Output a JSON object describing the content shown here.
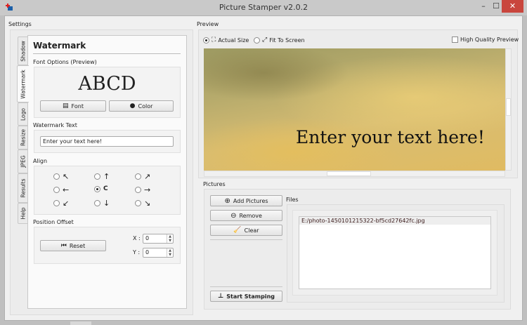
{
  "window": {
    "title": "Picture Stamper v2.0.2",
    "minimize": "–",
    "maximize": "☐",
    "close": "✕"
  },
  "settings": {
    "label": "Settings",
    "tabs": [
      "Shadow",
      "Watermark",
      "Logo",
      "Resize",
      "JPEG",
      "Results",
      "Help"
    ],
    "active_tab": "Watermark",
    "heading": "Watermark",
    "font_options_label": "Font Options (Preview)",
    "font_preview": "ABCD",
    "font_button": "Font",
    "color_button": "Color",
    "watermark_text_label": "Watermark Text",
    "watermark_text_value": "Enter your text here!",
    "align_label": "Align",
    "align_options": [
      "↖",
      "↑",
      "↗",
      "←",
      "C",
      "→",
      "↙",
      "↓",
      "↘"
    ],
    "align_selected": "C",
    "position_offset_label": "Position Offset",
    "reset_button": "Reset",
    "x_label": "X :",
    "x_value": "0",
    "y_label": "Y :",
    "y_value": "0"
  },
  "preview": {
    "label": "Preview",
    "actual_size": "Actual Size",
    "fit_to_screen": "Fit To Screen",
    "selected": "Actual Size",
    "high_quality": "High Quality Preview",
    "high_quality_checked": false,
    "overlay_text": "Enter your text here!"
  },
  "pictures": {
    "label": "Pictures",
    "add_button": "Add Pictures",
    "remove_button": "Remove",
    "clear_button": "Clear",
    "start_button": "Start Stamping",
    "files_label": "Files",
    "files": [
      "E:/photo-1450101215322-bf5cd27642fc.jpg"
    ]
  }
}
